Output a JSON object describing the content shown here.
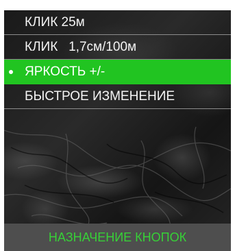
{
  "menu": {
    "items": [
      {
        "label": "КЛИК 25м"
      },
      {
        "label": "КЛИК   1,7см/100м"
      },
      {
        "label": "ЯРКОСТЬ +/-"
      },
      {
        "label": "БЫСТРОЕ ИЗМЕНЕНИЕ"
      }
    ],
    "selected_index": 2
  },
  "footer": {
    "title": "НАЗНАЧЕНИЕ КНОПОК"
  },
  "colors": {
    "highlight": "#21c421",
    "footer_text": "#37d137",
    "footer_bg": "#4e4e4e",
    "divider": "#8c8c8c"
  }
}
